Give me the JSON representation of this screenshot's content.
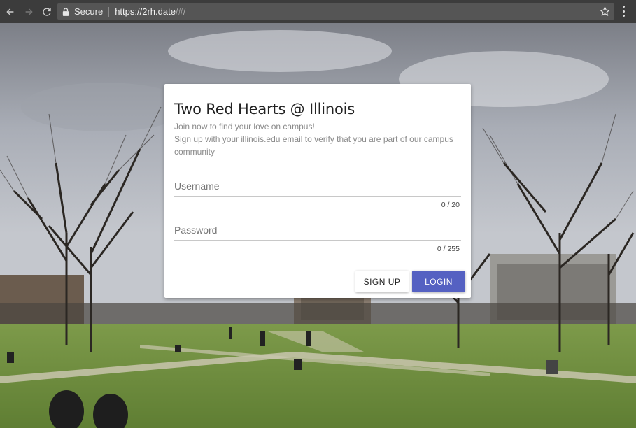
{
  "browser": {
    "secure_label": "Secure",
    "url_main": "https://2rh.date",
    "url_fragment": "/#/"
  },
  "card": {
    "title": "Two Red Hearts @ Illinois",
    "subtitle_line1": "Join now to find your love on campus!",
    "subtitle_line2": "Sign up with your illinois.edu email to verify that you are part of our campus community",
    "username": {
      "placeholder": "Username",
      "value": "",
      "counter": "0 / 20"
    },
    "password": {
      "placeholder": "Password",
      "value": "",
      "counter": "0 / 255"
    },
    "signup_label": "SIGN UP",
    "login_label": "LOGIN"
  },
  "colors": {
    "primary": "#5561c2",
    "card_bg": "#ffffff",
    "chrome_bg": "#3c3c3c"
  },
  "icons": [
    "back-icon",
    "forward-icon",
    "reload-icon",
    "lock-icon",
    "star-icon",
    "menu-icon"
  ]
}
